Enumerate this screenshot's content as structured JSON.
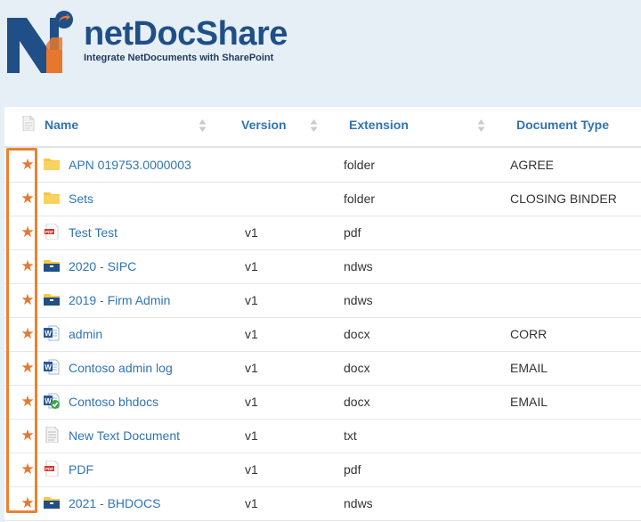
{
  "brand": {
    "name": "netDocShare",
    "tagline": "Integrate NetDocuments with SharePoint",
    "colors": {
      "blue": "#1f4f86",
      "orange": "#e8772e"
    }
  },
  "table": {
    "columns": [
      {
        "key": "name",
        "label": "Name"
      },
      {
        "key": "version",
        "label": "Version"
      },
      {
        "key": "extension",
        "label": "Extension"
      },
      {
        "key": "doctype",
        "label": "Document Type"
      }
    ],
    "rows": [
      {
        "favorite": "★",
        "icon": "folder-icon",
        "name": "APN 019753.0000003",
        "version": "",
        "extension": "folder",
        "doctype": "AGREE"
      },
      {
        "favorite": "★",
        "icon": "folder-icon",
        "name": "Sets",
        "version": "",
        "extension": "folder",
        "doctype": "CLOSING BINDER"
      },
      {
        "favorite": "★",
        "icon": "pdf-icon",
        "name": "Test Test",
        "version": "v1",
        "extension": "pdf",
        "doctype": ""
      },
      {
        "favorite": "★",
        "icon": "workspace-folder-icon",
        "name": "2020 - SIPC",
        "version": "v1",
        "extension": "ndws",
        "doctype": ""
      },
      {
        "favorite": "★",
        "icon": "workspace-folder-icon",
        "name": "2019 - Firm Admin",
        "version": "v1",
        "extension": "ndws",
        "doctype": ""
      },
      {
        "favorite": "★",
        "icon": "word-icon",
        "name": "admin",
        "version": "v1",
        "extension": "docx",
        "doctype": "CORR"
      },
      {
        "favorite": "★",
        "icon": "word-icon",
        "name": "Contoso admin log",
        "version": "v1",
        "extension": "docx",
        "doctype": "EMAIL"
      },
      {
        "favorite": "★",
        "icon": "word-checked-icon",
        "name": "Contoso bhdocs",
        "version": "v1",
        "extension": "docx",
        "doctype": "EMAIL"
      },
      {
        "favorite": "★",
        "icon": "text-file-icon",
        "name": "New Text Document",
        "version": "v1",
        "extension": "txt",
        "doctype": ""
      },
      {
        "favorite": "★",
        "icon": "pdf-icon",
        "name": "PDF",
        "version": "v1",
        "extension": "pdf",
        "doctype": ""
      },
      {
        "favorite": "★",
        "icon": "workspace-folder-icon",
        "name": "2021 - BHDOCS",
        "version": "v1",
        "extension": "ndws",
        "doctype": ""
      }
    ]
  }
}
